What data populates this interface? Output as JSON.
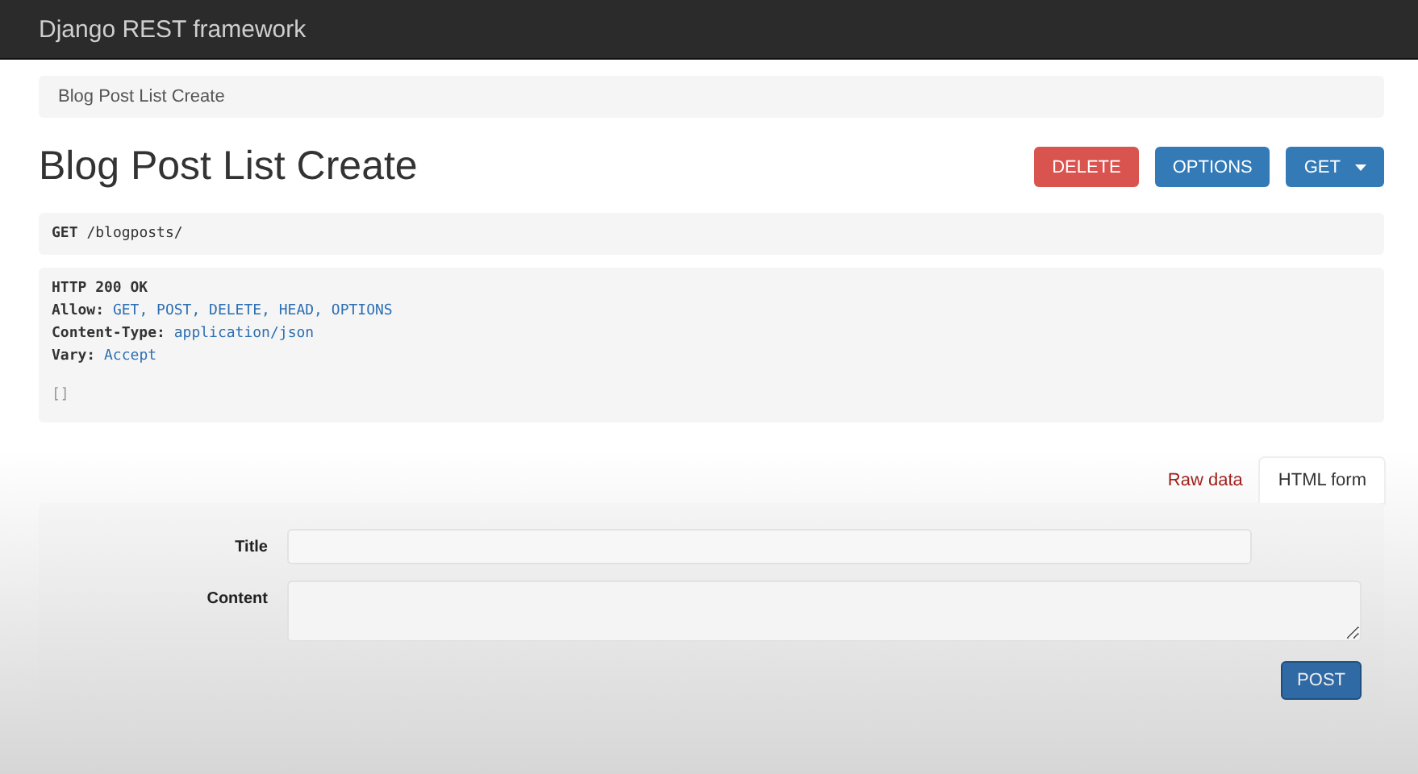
{
  "navbar": {
    "brand": "Django REST framework"
  },
  "breadcrumb": [
    "Blog Post List Create"
  ],
  "page_title": "Blog Post List Create",
  "actions": [
    {
      "label": "DELETE",
      "kind": "danger"
    },
    {
      "label": "OPTIONS",
      "kind": "primary"
    },
    {
      "label": "GET",
      "kind": "dropdown"
    }
  ],
  "request": {
    "method": "GET",
    "path": "/blogposts/"
  },
  "response": {
    "status": "HTTP 200 OK",
    "headers": [
      {
        "key": "Allow:",
        "value": "GET, POST, DELETE, HEAD, OPTIONS"
      },
      {
        "key": "Content-Type:",
        "value": "application/json"
      },
      {
        "key": "Vary:",
        "value": "Accept"
      }
    ],
    "body": "[]"
  },
  "tabs": [
    {
      "label": "Raw data",
      "selected": false
    },
    {
      "label": "HTML form",
      "selected": true
    }
  ],
  "form": {
    "fields": [
      {
        "label": "Title",
        "kind": "input"
      },
      {
        "label": "Content",
        "kind": "textarea"
      }
    ],
    "submit": "POST"
  }
}
